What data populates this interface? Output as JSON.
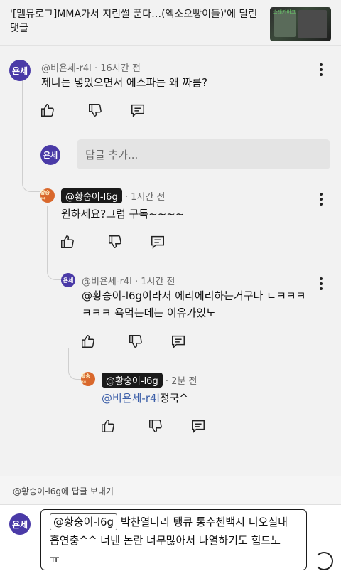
{
  "video_header": {
    "title": "'[멜뮤로그]MMA가서 지린썰 푼다…(엑소오빵이들)'에 달린 댓글",
    "thumbnail_tag": "스레기이고"
  },
  "comment": {
    "avatar_label": "욘세",
    "author": "@비욘세-r4l",
    "time": "16시간 전",
    "text": "제니는 넣었으면서 에스파는 왜 짜름?"
  },
  "reply_input": {
    "avatar_label": "욘세",
    "placeholder": "답글 추가..."
  },
  "replies": [
    {
      "avatar_label": "황숭**",
      "author": "@황숭이-l6g",
      "time": "1시간 전",
      "text": "원하세요?그럼 구독~~~~"
    },
    {
      "avatar_label": "욘세",
      "author": "@비욘세-r4l",
      "time": "1시간 전",
      "mention": "@황숭이-l6g",
      "text_line1": "이라서 에리에리하는거구나 ㄴㅋㅋㅋ",
      "text_line2": "ㅋㅋㅋ 욕먹는데는 이유가있노"
    },
    {
      "avatar_label": "황숭**",
      "author": "@황숭이-l6g",
      "time": "2분 전",
      "mention": "@비욘세-r4l",
      "text": "정국^"
    }
  ],
  "compose": {
    "reply_to_label": "@황숭이-l6g에 답글 보내기",
    "avatar_label": "욘세",
    "mention": "@황숭이-l6g",
    "line1": " 박찬열다리 탱큐 통수첸백시 디오실내",
    "line2": "흡연충^^ 너넨 논란 너무많아서 나열하기도 힘드노",
    "line3": "ㅠ"
  },
  "icons": {
    "like": "thumbs-up-icon",
    "dislike": "thumbs-down-icon",
    "reply": "comment-icon",
    "more": "more-vert-icon",
    "loading": "spinner-icon"
  }
}
